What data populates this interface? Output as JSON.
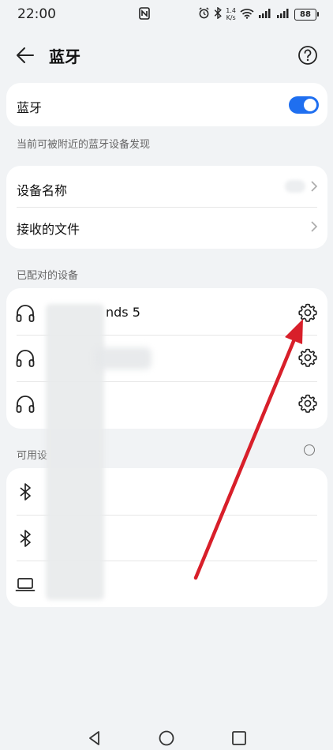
{
  "status_bar": {
    "time": "22:00",
    "net_speed_value": "1.4",
    "net_speed_unit": "K/s",
    "battery": "88"
  },
  "header": {
    "title": "蓝牙"
  },
  "bluetooth": {
    "label": "蓝牙",
    "enabled": true,
    "hint": "当前可被附近的蓝牙设备发现"
  },
  "settings": [
    {
      "label": "设备名称"
    },
    {
      "label": "接收的文件"
    }
  ],
  "paired": {
    "section_label": "已配对的设备",
    "devices": [
      {
        "name": "nds 5",
        "icon": "headphones-icon"
      },
      {
        "name": "",
        "icon": "headphones-icon"
      },
      {
        "name": "",
        "icon": "headphones-icon"
      }
    ]
  },
  "available": {
    "section_label": "可用设",
    "devices": [
      {
        "name": "",
        "icon": "bluetooth-icon"
      },
      {
        "name": "",
        "icon": "bluetooth-icon"
      },
      {
        "name": "",
        "icon": "laptop-icon"
      }
    ]
  },
  "colors": {
    "accent": "#1f6ff0",
    "annotation_arrow": "#d81f2a",
    "background": "#f1f3f5"
  }
}
